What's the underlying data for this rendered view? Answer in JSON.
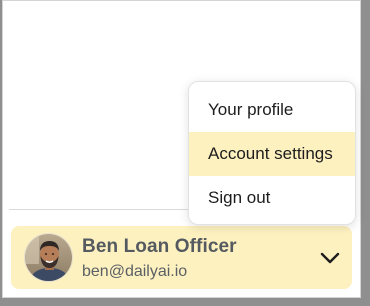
{
  "menu": {
    "items": [
      {
        "label": "Your profile",
        "active": false
      },
      {
        "label": "Account settings",
        "active": true
      },
      {
        "label": "Sign out",
        "active": false
      }
    ]
  },
  "user": {
    "name": "Ben Loan Officer",
    "email": "ben@dailyai.io",
    "avatar_icon": "user-photo"
  },
  "icons": {
    "expand": "chevron-down-icon"
  },
  "colors": {
    "highlight": "#fdf1c0",
    "name_text": "#555a60",
    "menu_text": "#1d1d1d"
  }
}
